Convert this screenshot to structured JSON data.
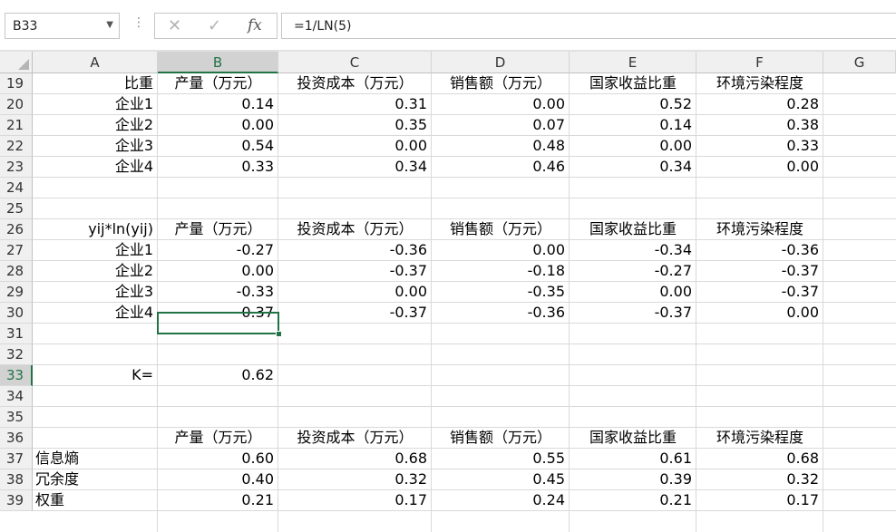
{
  "name_box": "B33",
  "formula": "=1/LN(5)",
  "formula_buttons": {
    "cancel": "✕",
    "enter": "✓",
    "fx": "fx"
  },
  "columns": [
    "A",
    "B",
    "C",
    "D",
    "E",
    "F",
    "G"
  ],
  "selected_column": "B",
  "selected_row": "33",
  "selected_cell": "B33",
  "rows": [
    {
      "num": "19",
      "cells": {
        "A": "比重",
        "B": "产量（万元）",
        "C": "投资成本（万元）",
        "D": "销售额（万元）",
        "E": "国家收益比重",
        "F": "环境污染程度"
      }
    },
    {
      "num": "20",
      "cells": {
        "A": "企业1",
        "B": "0.14",
        "C": "0.31",
        "D": "0.00",
        "E": "0.52",
        "F": "0.28"
      }
    },
    {
      "num": "21",
      "cells": {
        "A": "企业2",
        "B": "0.00",
        "C": "0.35",
        "D": "0.07",
        "E": "0.14",
        "F": "0.38"
      }
    },
    {
      "num": "22",
      "cells": {
        "A": "企业3",
        "B": "0.54",
        "C": "0.00",
        "D": "0.48",
        "E": "0.00",
        "F": "0.33"
      }
    },
    {
      "num": "23",
      "cells": {
        "A": "企业4",
        "B": "0.33",
        "C": "0.34",
        "D": "0.46",
        "E": "0.34",
        "F": "0.00"
      }
    },
    {
      "num": "24",
      "cells": {}
    },
    {
      "num": "25",
      "cells": {}
    },
    {
      "num": "26",
      "cells": {
        "A": "yij*ln(yij)",
        "B": "产量（万元）",
        "C": "投资成本（万元）",
        "D": "销售额（万元）",
        "E": "国家收益比重",
        "F": "环境污染程度"
      }
    },
    {
      "num": "27",
      "cells": {
        "A": "企业1",
        "B": "-0.27",
        "C": "-0.36",
        "D": "0.00",
        "E": "-0.34",
        "F": "-0.36"
      }
    },
    {
      "num": "28",
      "cells": {
        "A": "企业2",
        "B": "0.00",
        "C": "-0.37",
        "D": "-0.18",
        "E": "-0.27",
        "F": "-0.37"
      }
    },
    {
      "num": "29",
      "cells": {
        "A": "企业3",
        "B": "-0.33",
        "C": "0.00",
        "D": "-0.35",
        "E": "0.00",
        "F": "-0.37"
      }
    },
    {
      "num": "30",
      "cells": {
        "A": "企业4",
        "B": "-0.37",
        "C": "-0.37",
        "D": "-0.36",
        "E": "-0.37",
        "F": "0.00"
      }
    },
    {
      "num": "31",
      "cells": {}
    },
    {
      "num": "32",
      "cells": {}
    },
    {
      "num": "33",
      "cells": {
        "A": "K=",
        "B": "0.62"
      }
    },
    {
      "num": "34",
      "cells": {}
    },
    {
      "num": "35",
      "cells": {}
    },
    {
      "num": "36",
      "cells": {
        "B": "产量（万元）",
        "C": "投资成本（万元）",
        "D": "销售额（万元）",
        "E": "国家收益比重",
        "F": "环境污染程度"
      }
    },
    {
      "num": "37",
      "cells": {
        "A": "信息熵",
        "B": "0.60",
        "C": "0.68",
        "D": "0.55",
        "E": "0.61",
        "F": "0.68"
      }
    },
    {
      "num": "38",
      "cells": {
        "A": "冗余度",
        "B": "0.40",
        "C": "0.32",
        "D": "0.45",
        "E": "0.39",
        "F": "0.32"
      }
    },
    {
      "num": "39",
      "cells": {
        "A": "权重",
        "B": "0.21",
        "C": "0.17",
        "D": "0.24",
        "E": "0.21",
        "F": "0.17"
      }
    }
  ]
}
